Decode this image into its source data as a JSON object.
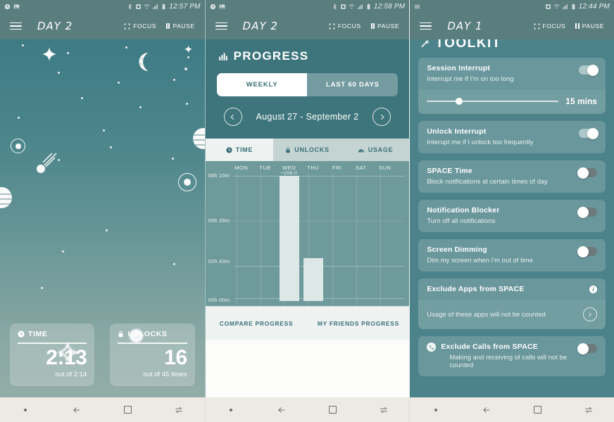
{
  "screens": [
    {
      "statusbar": {
        "time": "12:57 PM",
        "icons": [
          "clock-icon",
          "image-icon",
          "bluetooth-icon",
          "alarm-icon",
          "wifi-icon",
          "signal-icon",
          "battery-icon"
        ]
      },
      "appbar": {
        "menu": "menu-icon",
        "title": "DAY 2",
        "focus_label": "FOCUS",
        "pause_label": "PAUSE"
      },
      "stats": [
        {
          "label": "TIME",
          "icon": "clock-icon",
          "value": "2:13",
          "sub": "out of 2:14"
        },
        {
          "label": "UNLOCKS",
          "icon": "lock-icon",
          "value": "16",
          "sub": "out of 45 times"
        }
      ]
    },
    {
      "statusbar": {
        "time": "12:58 PM"
      },
      "appbar": {
        "title": "DAY 2",
        "focus_label": "FOCUS",
        "pause_label": "PAUSE"
      },
      "progress": {
        "heading": "PROGRESS",
        "heading_icon": "bar-chart-icon",
        "segments": [
          {
            "label": "WEEKLY",
            "active": true
          },
          {
            "label": "LAST 60 DAYS",
            "active": false
          }
        ],
        "date_range": "August 27  -  September 2",
        "prev_icon": "chevron-left-icon",
        "next_icon": "chevron-right-icon",
        "tabs": [
          {
            "label": "TIME",
            "icon": "clock-icon",
            "active": true
          },
          {
            "label": "UNLOCKS",
            "icon": "lock-icon",
            "active": false
          },
          {
            "label": "USAGE",
            "icon": "gauge-icon",
            "active": false
          }
        ],
        "footer": [
          {
            "label": "COMPARE PROGRESS"
          },
          {
            "label": "MY FRIENDS PROGRESS"
          }
        ]
      }
    },
    {
      "statusbar": {
        "time": "12:44 PM"
      },
      "appbar": {
        "title": "DAY 1",
        "focus_label": "FOCUS",
        "pause_label": "PAUSE"
      },
      "toolkit": {
        "heading": "TOOLKIT",
        "heading_icon": "wrench-icon",
        "items": [
          {
            "title": "Session Interrupt",
            "sub": "Interrupt me if I'm on too long",
            "toggle": "on",
            "slider": {
              "value_label": "15 mins",
              "fill_percent": 22
            }
          },
          {
            "title": "Unlock Interrupt",
            "sub": "Interupt me if I unlock too frequently",
            "toggle": "on"
          },
          {
            "title": "SPACE Time",
            "sub": "Block notifications at certain times of day",
            "toggle": "off"
          },
          {
            "title": "Notification Blocker",
            "sub": "Turn off all notifications",
            "toggle": "off"
          },
          {
            "title": "Screen Dimming",
            "sub": "Dim my screen when I'm out of time",
            "toggle": "off"
          },
          {
            "title": "Exclude Apps from SPACE",
            "info_icon": "info-icon",
            "sub": "Usage of these apps will not be counted",
            "arrow_icon": "chevron-right-icon"
          },
          {
            "title": "Exclude Calls from SPACE",
            "leading_icon": "phone-icon",
            "sub": "Making and receiving of calls will not be counted",
            "toggle": "off"
          }
        ]
      }
    }
  ],
  "navbar": {
    "items": [
      "dot-icon",
      "back-arrow-icon",
      "home-square-icon",
      "recents-icon"
    ]
  },
  "chart_data": {
    "type": "bar",
    "title": "PROGRESS",
    "subtitle": "August 27  -  September 2",
    "categories": [
      "MON",
      "TUE",
      "WED",
      "THU",
      "FRI",
      "SAT",
      "SUN"
    ],
    "values": [
      0,
      0,
      490,
      163,
      0,
      0,
      0
    ],
    "value_unit": "minutes",
    "bar_labels": [
      "",
      "",
      "+208.0",
      "",
      "",
      "",
      ""
    ],
    "ytick_labels": [
      "00h 00m",
      "02h 43m",
      "05h 26m",
      "08h 10m"
    ],
    "ytick_values": [
      0,
      163,
      326,
      490
    ],
    "ylim": [
      0,
      490
    ],
    "xlabel": "",
    "ylabel": "",
    "grid": true,
    "legend": "none"
  },
  "colors": {
    "appbar": "#5a7d7e",
    "progress_bg": "#3e757c",
    "toolkit_bg": "#4c8289",
    "chart_bg": "#6f9a9b",
    "bar_fill": "#e5eeed",
    "accent_text": "#3b6f77",
    "navbar_bg": "#eceae3"
  }
}
